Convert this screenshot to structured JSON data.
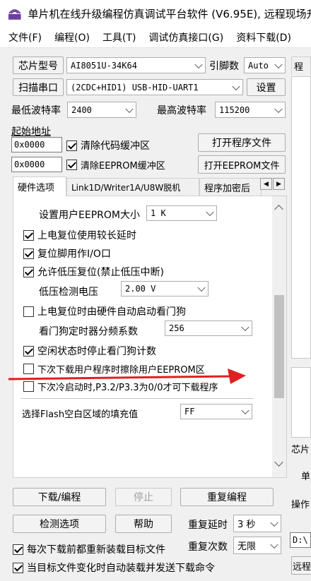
{
  "window": {
    "title": "单片机在线升级编程仿真调试平台软件 (V6.95E), 远程现场升"
  },
  "menu": [
    "文件(F)",
    "编程(O)",
    "工具(T)",
    "调试仿真接口(G)",
    "资料下载(D)"
  ],
  "chip": {
    "label": "芯片型号",
    "value": "AI8051U-34K64",
    "pins_label": "引脚数",
    "pins_value": "Auto"
  },
  "scan": {
    "button": "扫描串口",
    "port_value": "(2CDC+HID1) USB-HID-UART1",
    "settings_button": "设置"
  },
  "baud": {
    "min_label": "最低波特率",
    "min_value": "2400",
    "max_label": "最高波特率",
    "max_value": "115200"
  },
  "address": {
    "label": "起始地址",
    "code_addr": "0x0000",
    "clear_code_label": "清除代码缓冲区",
    "clear_code_checked": true,
    "open_program_button": "打开程序文件",
    "eeprom_addr": "0x0000",
    "clear_eeprom_label": "清除EEPROM缓冲区",
    "clear_eeprom_checked": true,
    "open_eeprom_button": "打开EEPROM文件"
  },
  "tabs": [
    "硬件选项",
    "Link1D/Writer1A/U8W脱机",
    "程序加密后"
  ],
  "hw": {
    "eeprom_size_label": "设置用户EEPROM大小",
    "eeprom_size_value": "1  K",
    "opt_long_delay": "上电复位使用较长延时",
    "opt_reset_io": "复位脚用作I/O口",
    "opt_low_volt_reset": "允许低压复位(禁止低压中断)",
    "low_volt_label": "低压检测电压",
    "low_volt_value": "2.00 V",
    "opt_wdt_auto": "上电复位时由硬件自动启动看门狗",
    "wdt_div_label": "看门狗定时器分频系数",
    "wdt_div_value": "256",
    "opt_idle_wdt_stop": "空闲状态时停止看门狗计数",
    "opt_erase_eeprom": "下次下载用户程序时擦除用户EEPROM区",
    "opt_cold_start": "下次冷启动时,P3.2/P3.3为0/0才可下载程序",
    "fill_label": "选择Flash空白区域的填充值",
    "fill_value": "FF",
    "checked": {
      "long_delay": true,
      "reset_io": true,
      "low_volt_reset": true,
      "wdt_auto": false,
      "idle_wdt_stop": true,
      "erase_eeprom": false,
      "cold_start": false
    }
  },
  "actions": {
    "download": "下载/编程",
    "stop": "停止",
    "repeat": "重复编程",
    "detect": "检测选项",
    "help": "帮助",
    "repeat_delay_label": "重复延时",
    "repeat_delay_value": "3 秒",
    "repeat_count_label": "重复次数",
    "repeat_count_value": "无限",
    "reload_label": "每次下载前都重新装载目标文件",
    "reload_checked": true,
    "autosend_label": "当目标文件变化时自动装载并发送下载命令",
    "autosend_checked": true
  },
  "right": {
    "tab_label": "程",
    "chip_label": "芯片",
    "single_label": "单",
    "op_label": "操作",
    "path_text": "D:\\",
    "remote_button": "远程"
  },
  "colors": {
    "arrow": "#e02020",
    "window_bg": "#f0f0f0",
    "border": "#adadad"
  }
}
